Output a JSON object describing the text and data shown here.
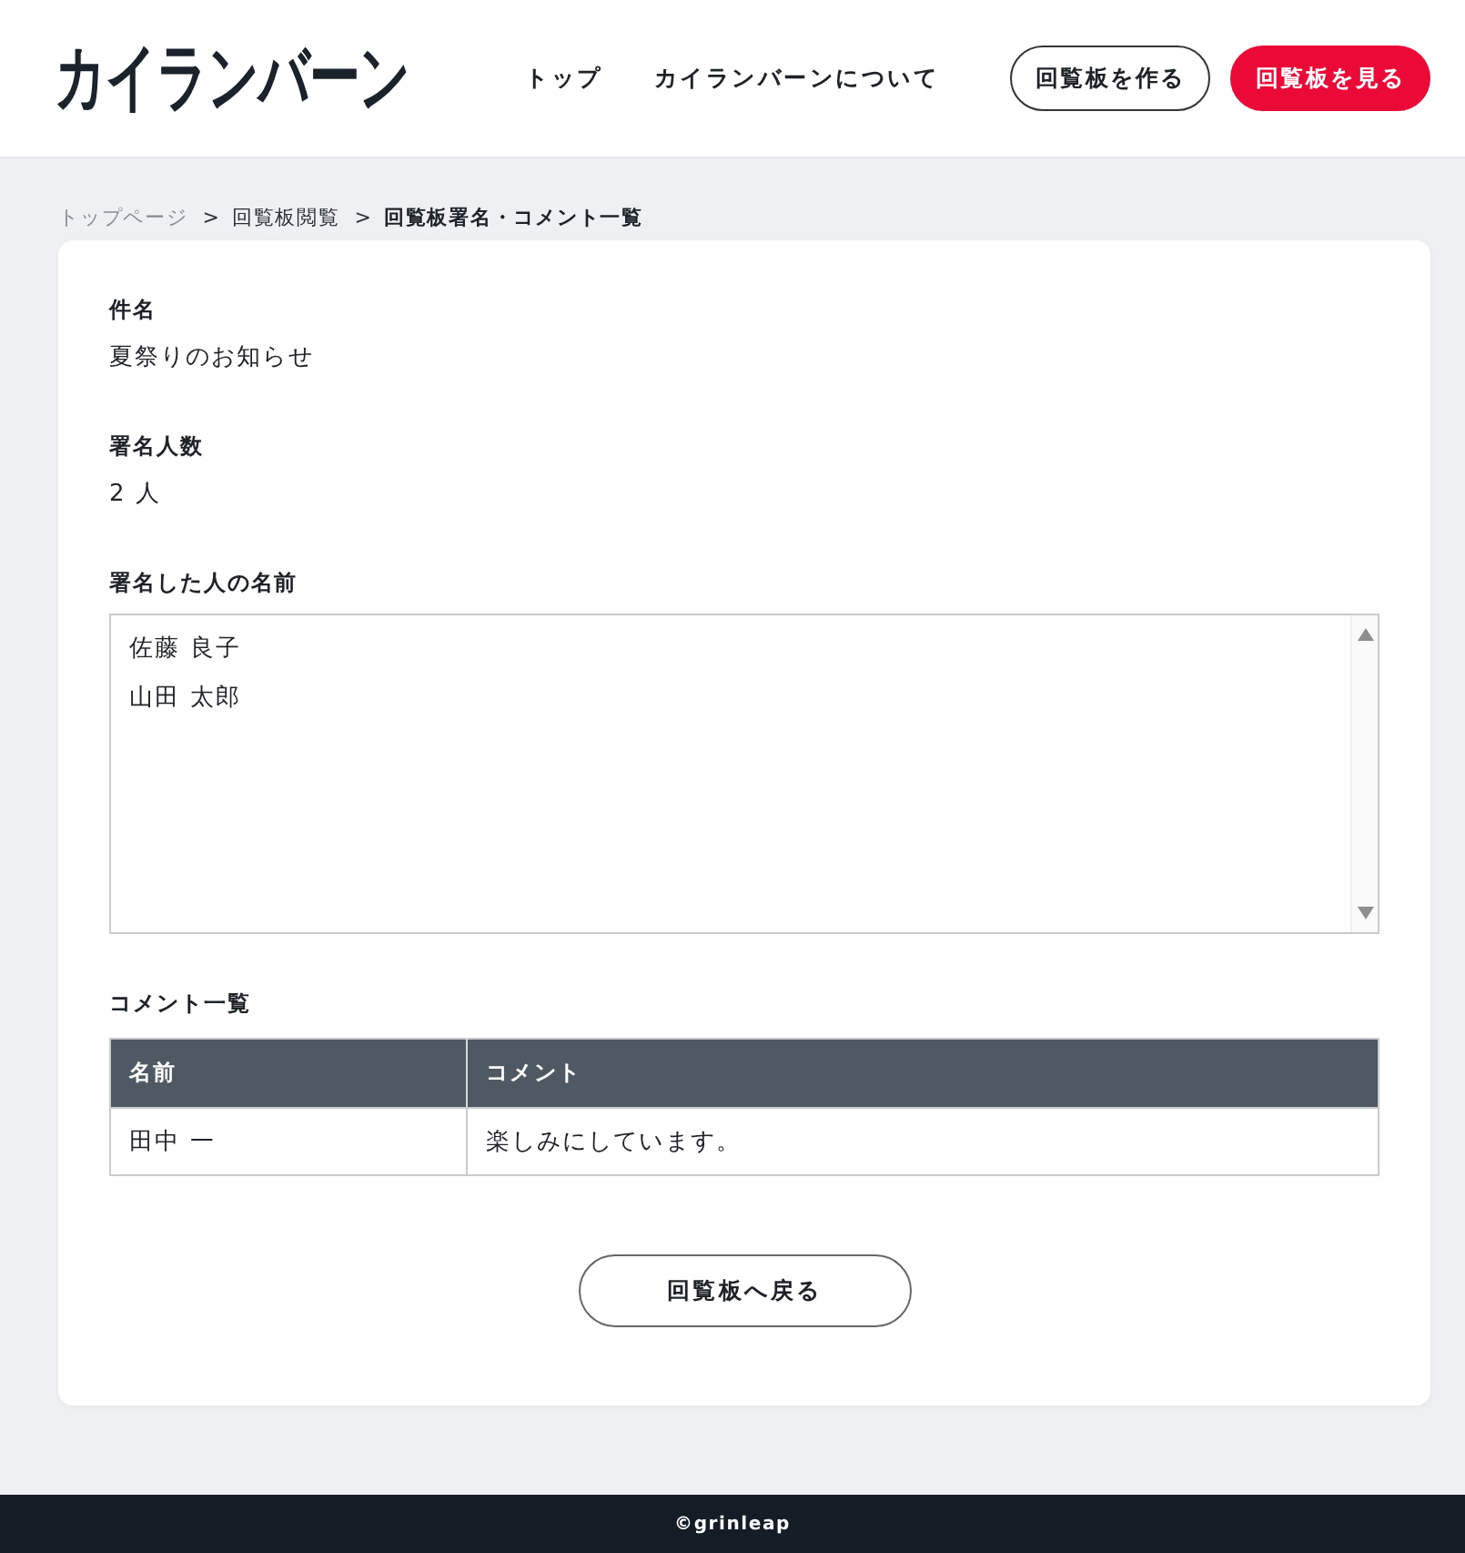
{
  "header": {
    "logo": "カイランバーン",
    "nav": [
      {
        "label": "トップ"
      },
      {
        "label": "カイランバーンについて"
      }
    ],
    "buttons": [
      {
        "label": "回覧板を作る",
        "kind": "outline"
      },
      {
        "label": "回覧板を見る",
        "kind": "primary"
      }
    ]
  },
  "breadcrumb": [
    {
      "kind": "home",
      "label": "トップページ"
    },
    {
      "kind": "separator",
      "label": ">"
    },
    {
      "kind": "link",
      "label": "回覧板閲覧"
    },
    {
      "kind": "separator",
      "label": ">"
    },
    {
      "kind": "current",
      "label": "回覧板署名・コメント一覧"
    }
  ],
  "fields": [
    {
      "label": "件名",
      "value": "夏祭りのお知らせ"
    },
    {
      "label": "署名人数",
      "value": "2 人"
    }
  ],
  "signers": {
    "label": "署名した人の名前",
    "names": [
      "佐藤 良子",
      "山田 太郎"
    ]
  },
  "comments": {
    "label": "コメント一覧",
    "columns": [
      "名前",
      "コメント"
    ],
    "rows": [
      [
        "田中 一",
        "楽しみにしています。"
      ]
    ]
  },
  "back_button": "回覧板へ戻る",
  "footer": {
    "copyright": "©grinleap"
  }
}
